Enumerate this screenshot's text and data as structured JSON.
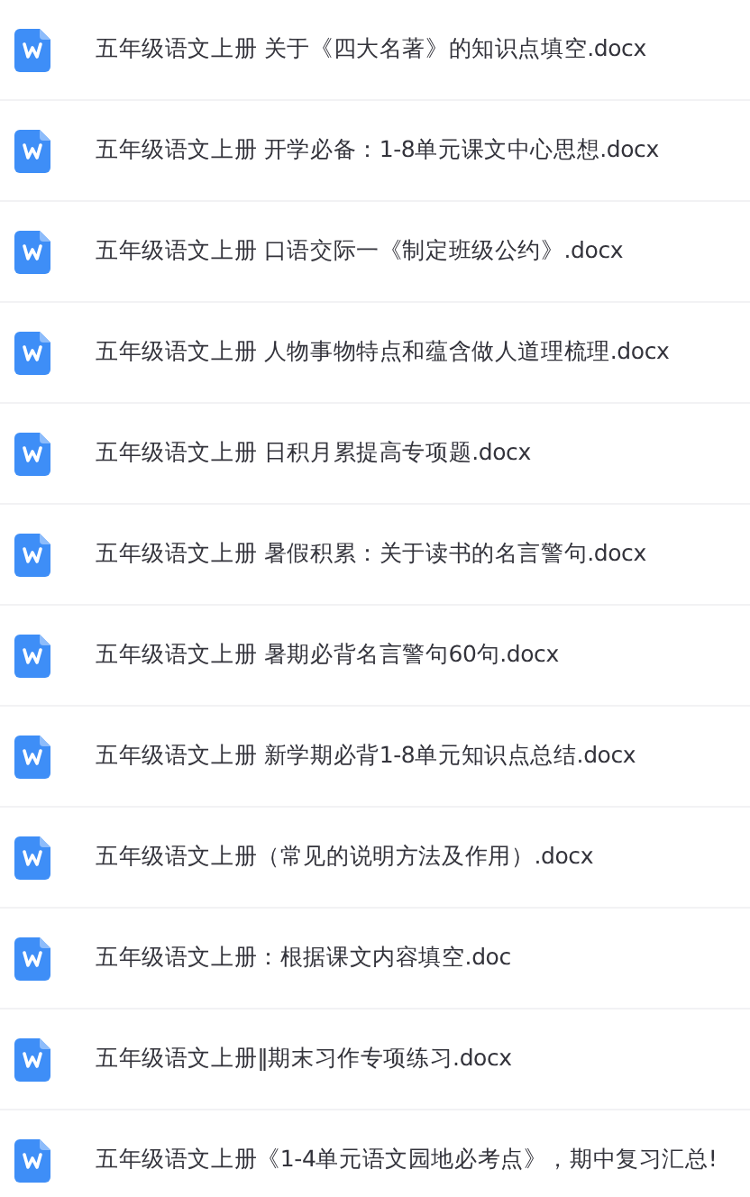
{
  "files": [
    {
      "name": "五年级语文上册 关于《四大名著》的知识点填空.docx",
      "kind": "word"
    },
    {
      "name": "五年级语文上册 开学必备：1-8单元课文中心思想.docx",
      "kind": "word"
    },
    {
      "name": "五年级语文上册 口语交际一《制定班级公约》.docx",
      "kind": "word"
    },
    {
      "name": "五年级语文上册 人物事物特点和蕴含做人道理梳理.docx",
      "kind": "word"
    },
    {
      "name": "五年级语文上册 日积月累提高专项题.docx",
      "kind": "word"
    },
    {
      "name": "五年级语文上册 暑假积累：关于读书的名言警句.docx",
      "kind": "word"
    },
    {
      "name": "五年级语文上册 暑期必背名言警句60句.docx",
      "kind": "word"
    },
    {
      "name": "五年级语文上册 新学期必背1-8单元知识点总结.docx",
      "kind": "word"
    },
    {
      "name": "五年级语文上册（常见的说明方法及作用）.docx",
      "kind": "word"
    },
    {
      "name": "五年级语文上册：根据课文内容填空.doc",
      "kind": "word"
    },
    {
      "name": "五年级语文上册‖期末习作专项练习.docx",
      "kind": "word"
    },
    {
      "name": "五年级语文上册《1-4单元语文园地必考点》，期中复习汇总!",
      "kind": "word"
    }
  ]
}
